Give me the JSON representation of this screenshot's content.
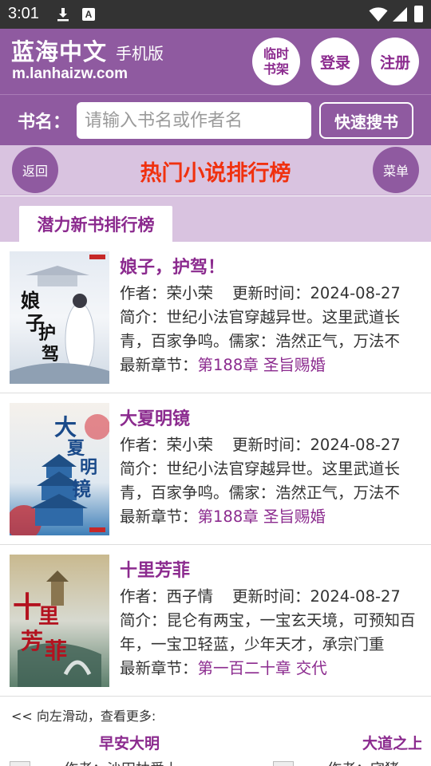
{
  "status_bar": {
    "time": "3:01",
    "icons": [
      "download-icon",
      "a-icon",
      "wifi-icon",
      "signal-icon",
      "battery-icon"
    ],
    "a_letter": "A"
  },
  "header": {
    "site_name": "蓝海中文",
    "site_sub": "手机版",
    "site_url": "m.lanhaizw.com",
    "shelf_line1": "临时",
    "shelf_line2": "书架",
    "login": "登录",
    "register": "注册"
  },
  "search": {
    "label": "书名：",
    "placeholder": "请输入书名或作者名",
    "button": "快速搜书"
  },
  "titlebar": {
    "back": "返回",
    "title": "热门小说排行榜",
    "menu": "菜单"
  },
  "tab": {
    "active": "潜力新书排行榜"
  },
  "books": [
    {
      "title": "娘子，护驾！",
      "author": "作者：荣小荣",
      "update": "更新时间：2024-08-27",
      "intro": "简介：世纪小法官穿越异世。这里武道长青，百家争鸣。儒家：浩然正气，万法不",
      "latest_label": "最新章节：",
      "latest": "第188章 圣旨赐婚",
      "cover_text": "娘子护驾"
    },
    {
      "title": "大夏明镜",
      "author": "作者：荣小荣",
      "update": "更新时间：2024-08-27",
      "intro": "简介：世纪小法官穿越异世。这里武道长青，百家争鸣。儒家：浩然正气，万法不",
      "latest_label": "最新章节：",
      "latest": "第188章 圣旨赐婚",
      "cover_text": "大夏明镜"
    },
    {
      "title": "十里芳菲",
      "author": "作者：西子情",
      "update": "更新时间：2024-08-27",
      "intro": "简介：昆仑有两宝，一宝玄天境，可预知百年，一宝卫轻蓝，少年天才，承宗门重",
      "latest_label": "最新章节：",
      "latest": "第一百二十章 交代",
      "cover_text": "十里芳菲"
    }
  ],
  "footer": {
    "hint": "<< 向左滑动，查看更多:",
    "rec1_title": "早安大明",
    "rec1_author": "作者：沙田柚爱上",
    "rec2_title": "大道之上",
    "rec2_author": "作者：宅猪"
  }
}
